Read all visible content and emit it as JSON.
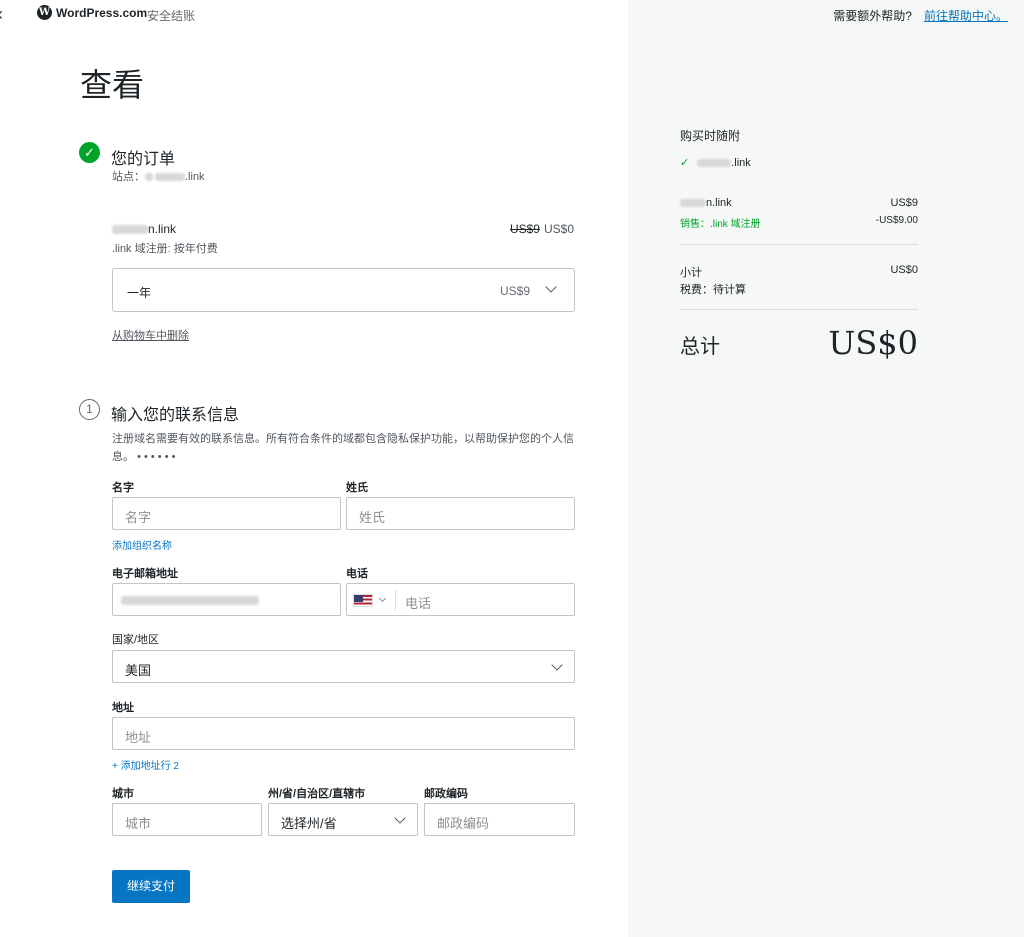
{
  "header": {
    "back_glyph": "‹",
    "logo_text": "WordPress.com",
    "secure_label": "安全结账",
    "help_question": "需要额外帮助?",
    "help_link": "前往帮助中心。"
  },
  "page_title": "查看",
  "order": {
    "title": "您的订单",
    "site_label": "站点：",
    "site_domain_suffix": ".link",
    "item_name_suffix": "n.link",
    "item_sub": ".link 域注册: 按年付费",
    "original_price": "US$9",
    "price": "US$0",
    "period_label": "一年",
    "period_price": "US$9",
    "remove_link": "从购物车中删除"
  },
  "contact": {
    "step_number": "1",
    "title": "输入您的联系信息",
    "description": "注册域名需要有效的联系信息。所有符合条件的域都包含隐私保护功能，以帮助保护您的个人信息。",
    "description_dots": "• • • • • •",
    "first_name_label": "名字",
    "first_name_placeholder": "名字",
    "last_name_label": "姓氏",
    "last_name_placeholder": "姓氏",
    "add_org_link": "添加组织名称",
    "email_label": "电子邮箱地址",
    "phone_label": "电话",
    "phone_placeholder": "电话",
    "country_label": "国家/地区",
    "country_value": "美国",
    "address_label": "地址",
    "address_placeholder": "地址",
    "add_address_link": "+ 添加地址行 2",
    "city_label": "城市",
    "city_placeholder": "城市",
    "state_label": "州/省/自治区/直辖市",
    "state_value": "选择州/省",
    "postal_label": "邮政编码",
    "postal_placeholder": "邮政编码",
    "continue_button": "继续支付"
  },
  "summary": {
    "included_title": "购买时随附",
    "included_item_suffix": ".link",
    "line_item_suffix": "n.link",
    "line_item_price": "US$9",
    "sale_label": "销售：.link 域注册",
    "sale_amount": "-US$9.00",
    "subtotal_label": "小计",
    "subtotal_value": "US$0",
    "tax_label": "税费：待计算",
    "total_label": "总计",
    "total_value": "US$0"
  },
  "colors": {
    "primary": "#0675c4",
    "success": "#00a32a",
    "sidebar_bg": "#f6f7f7"
  }
}
